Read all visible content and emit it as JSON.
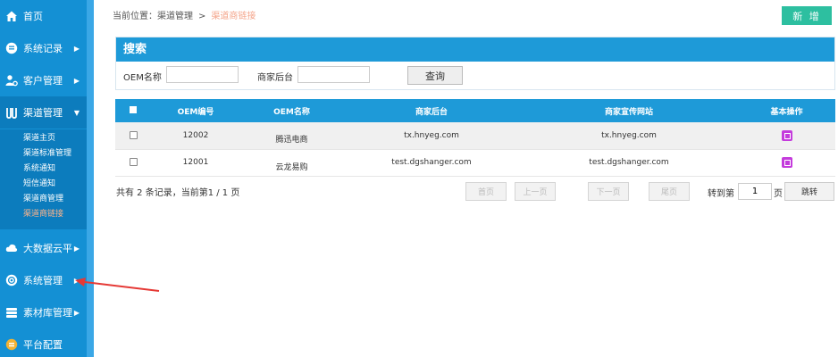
{
  "sidebar": {
    "items": [
      {
        "label": "首页",
        "icon": "home-icon",
        "has_arrow": false
      },
      {
        "label": "系统记录",
        "icon": "record-icon",
        "has_arrow": true
      },
      {
        "label": "客户管理",
        "icon": "users-icon",
        "has_arrow": true
      },
      {
        "label": "渠道管理",
        "icon": "channel-icon",
        "has_arrow": true,
        "expanded": true
      },
      {
        "label": "大数据云平",
        "icon": "cloud-icon",
        "has_arrow": true
      },
      {
        "label": "系统管理",
        "icon": "settings-icon",
        "has_arrow": true
      },
      {
        "label": "素材库管理",
        "icon": "library-icon",
        "has_arrow": true
      },
      {
        "label": "平台配置",
        "icon": "platform-icon",
        "has_arrow": false
      }
    ],
    "submenu": [
      "渠道主页",
      "渠道标准管理",
      "系统通知",
      "短信通知",
      "渠道商管理",
      "渠道商链接"
    ],
    "submenu_active_index": 5
  },
  "breadcrumb": {
    "prefix": "当前位置：渠道管理",
    "separator": ">",
    "current": "渠道商链接"
  },
  "toolbar": {
    "add_label": "新 增"
  },
  "search": {
    "title": "搜索",
    "oem_name_label": "OEM名称",
    "oem_name_value": "",
    "backend_label": "商家后台",
    "backend_value": "",
    "query_label": "查询"
  },
  "table": {
    "headers": [
      "OEM编号",
      "OEM名称",
      "商家后台",
      "商家宣传网站",
      "基本操作"
    ],
    "rows": [
      {
        "id": "12002",
        "name": "腾迅电商",
        "backend": "tx.hnyeg.com",
        "site": "tx.hnyeg.com"
      },
      {
        "id": "12001",
        "name": "云龙易购",
        "backend": "test.dgshanger.com",
        "site": "test.dgshanger.com"
      }
    ]
  },
  "pagination": {
    "info": "共有 2 条记录，当前第1 / 1 页",
    "first": "首页",
    "prev": "上一页",
    "next": "下一页",
    "last": "尾页",
    "goto_prefix": "转到第",
    "goto_value": "1",
    "goto_suffix": "页",
    "jump": "跳转"
  },
  "colors": {
    "sidebar": "#1490d4",
    "header_blue": "#1e9ad8",
    "add_button": "#2dbfa0",
    "edit_icon": "#c43bdc",
    "active_link": "#f4a48a",
    "annotation_arrow": "#e53935"
  }
}
